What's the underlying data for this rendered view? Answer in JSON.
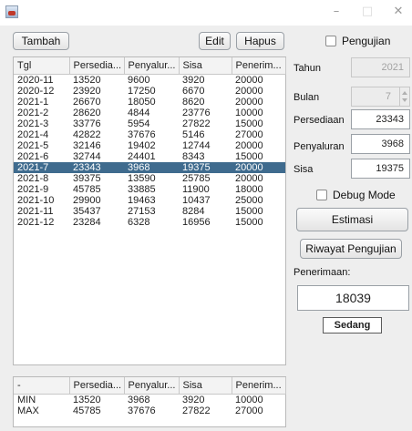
{
  "window": {
    "controls": {
      "minimize": "–",
      "maximize": "□",
      "close": "✕"
    }
  },
  "toolbar": {
    "tambah": "Tambah",
    "edit": "Edit",
    "hapus": "Hapus"
  },
  "main_table": {
    "headers": [
      "Tgl",
      "Persedia...",
      "Penyalur...",
      "Sisa",
      "Penerim..."
    ],
    "rows": [
      [
        "2020-11",
        "13520",
        "9600",
        "3920",
        "20000"
      ],
      [
        "2020-12",
        "23920",
        "17250",
        "6670",
        "20000"
      ],
      [
        "2021-1",
        "26670",
        "18050",
        "8620",
        "20000"
      ],
      [
        "2021-2",
        "28620",
        "4844",
        "23776",
        "10000"
      ],
      [
        "2021-3",
        "33776",
        "5954",
        "27822",
        "15000"
      ],
      [
        "2021-4",
        "42822",
        "37676",
        "5146",
        "27000"
      ],
      [
        "2021-5",
        "32146",
        "19402",
        "12744",
        "20000"
      ],
      [
        "2021-6",
        "32744",
        "24401",
        "8343",
        "15000"
      ],
      [
        "2021-7",
        "23343",
        "3968",
        "19375",
        "20000"
      ],
      [
        "2021-8",
        "39375",
        "13590",
        "25785",
        "20000"
      ],
      [
        "2021-9",
        "45785",
        "33885",
        "11900",
        "18000"
      ],
      [
        "2021-10",
        "29900",
        "19463",
        "10437",
        "25000"
      ],
      [
        "2021-11",
        "35437",
        "27153",
        "8284",
        "15000"
      ],
      [
        "2021-12",
        "23284",
        "6328",
        "16956",
        "15000"
      ]
    ],
    "selected_row_label": "2021-7"
  },
  "summary_table": {
    "headers": [
      "-",
      "Persedia...",
      "Penyalur...",
      "Sisa",
      "Penerim..."
    ],
    "rows": [
      [
        "MIN",
        "13520",
        "3968",
        "3920",
        "10000"
      ],
      [
        "MAX",
        "45785",
        "37676",
        "27822",
        "27000"
      ]
    ]
  },
  "form": {
    "pengujian_label": "Pengujian",
    "tahun_label": "Tahun",
    "tahun_value": "2021",
    "bulan_label": "Bulan",
    "bulan_value": "7",
    "persediaan_label": "Persediaan",
    "persediaan_value": "23343",
    "penyaluran_label": "Penyaluran",
    "penyaluran_value": "3968",
    "sisa_label": "Sisa",
    "sisa_value": "19375",
    "debug_label": "Debug Mode",
    "estimasi_button": "Estimasi",
    "riwayat_button": "Riwayat Pengujian",
    "penerimaan_label": "Penerimaan:",
    "penerimaan_value": "18039",
    "result_badge": "Sedang"
  },
  "colors": {
    "selection": "#3f6b8e"
  }
}
